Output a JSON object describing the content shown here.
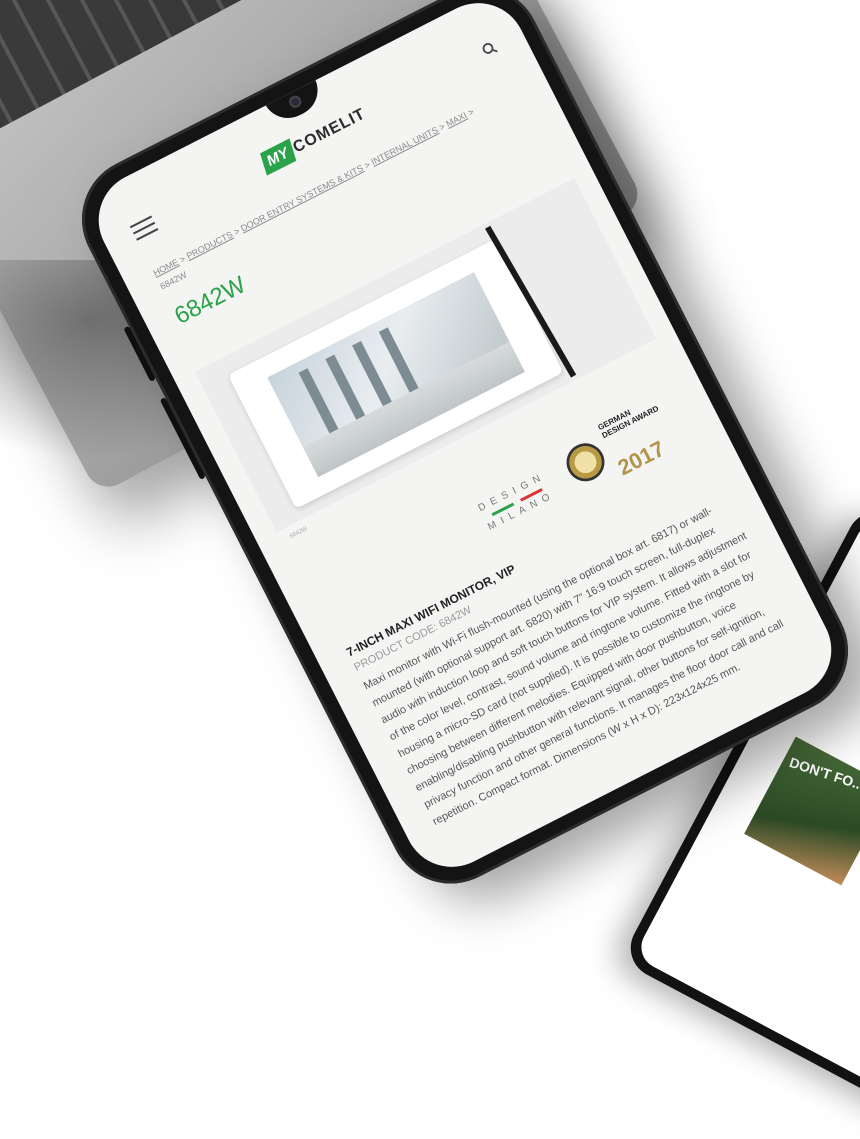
{
  "header": {
    "menu_icon": "hamburger-icon",
    "logo_my": "MY",
    "logo_text": "COMELIT",
    "search_icon": "search-icon"
  },
  "breadcrumb": {
    "items": [
      "HOME",
      "PRODUCTS",
      "DOOR ENTRY SYSTEMS & KITS",
      "INTERNAL UNITS",
      "MAXI"
    ],
    "separator": ">",
    "current": "6842W"
  },
  "page_title": "6842W",
  "product_image_caption": "6842W",
  "awards": {
    "design_top": "DESIGN",
    "design_bottom": "MILANO",
    "gda_text": "GERMAN DESIGN AWARD",
    "gda_year": "2017"
  },
  "description": {
    "title": "7-INCH MAXI WIFI MONITOR, VIP",
    "code": "PRODUCT CODE: 6842W",
    "body": "Maxi monitor with Wi-Fi flush-mounted (using the optional box art. 6817) or wall-mounted (with optional support art. 6820) with 7\" 16:9 touch screen, full-duplex audio with induction loop and soft touch buttons for VIP system. It allows adjustment of the color level, contrast, sound volume and ringtone volume. Fitted with a slot for housing a micro-SD card (not supplied). It is possible to customize the ringtone by choosing between different melodies. Equipped with door pushbutton, voice enabling/disabling pushbutton with relevant signal, other buttons for self-ignition, privacy function and other general functions. It manages the floor door call and call repetition. Compact format. Dimensions (W x H x D): 223x124x25 mm."
  },
  "tablet": {
    "headline": "DON'T FO..."
  },
  "colors": {
    "brand_green": "#2aa24a",
    "title_green": "#2aa24a",
    "gold": "#b3944a"
  }
}
